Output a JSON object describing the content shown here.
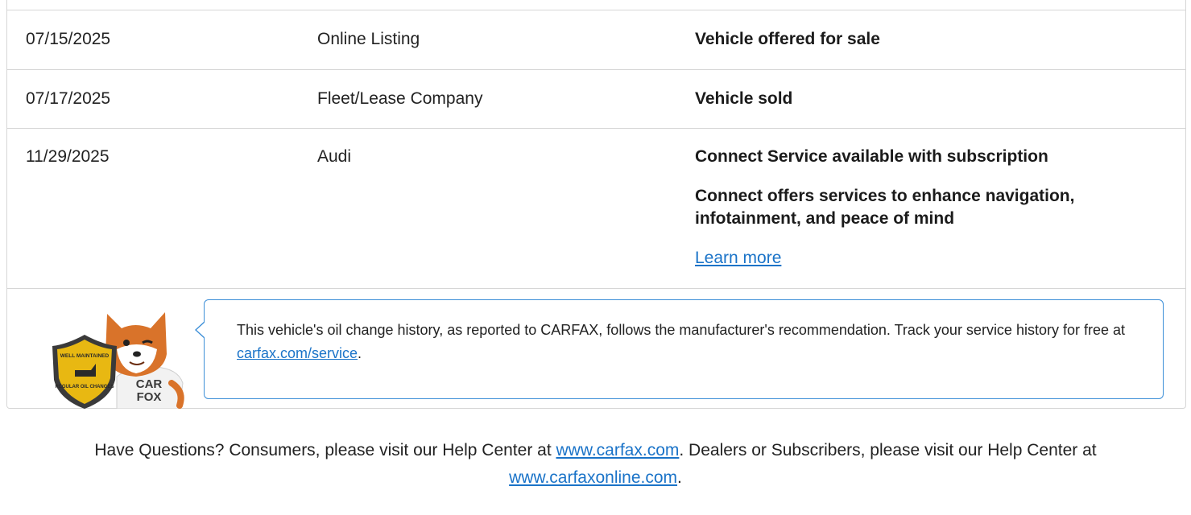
{
  "history": {
    "rows": [
      {
        "date": "07/15/2025",
        "source": "Online Listing",
        "comments": [
          "Vehicle offered for sale"
        ]
      },
      {
        "date": "07/17/2025",
        "source": "Fleet/Lease Company",
        "comments": [
          "Vehicle sold"
        ]
      },
      {
        "date": "11/29/2025",
        "source": "Audi",
        "comments": [
          "Connect Service available with subscription",
          "Connect offers services to enhance navigation, infotainment, and peace of mind"
        ],
        "link": "Learn more"
      }
    ]
  },
  "oil": {
    "badge_top": "WELL MAINTAINED",
    "badge_bottom": "REGULAR OIL CHANGES",
    "shirt_line1": "CAR",
    "shirt_line2": "FOX",
    "text_prefix": "This vehicle's oil change history, as reported to CARFAX, follows the manufacturer's recommendation. Track your service history for free at ",
    "link": "carfax.com/service",
    "text_suffix": "."
  },
  "footer": {
    "prefix": "Have Questions? Consumers, please visit our Help Center at ",
    "link1": "www.carfax.com",
    "middle": ". Dealers or Subscribers, please visit our Help Center at ",
    "link2": "www.carfaxonline.com",
    "suffix": "."
  },
  "colors": {
    "link": "#1a73c8",
    "bubble_border": "#3d8fd8",
    "badge_gold": "#e8b812",
    "fox_orange": "#d9732a"
  }
}
